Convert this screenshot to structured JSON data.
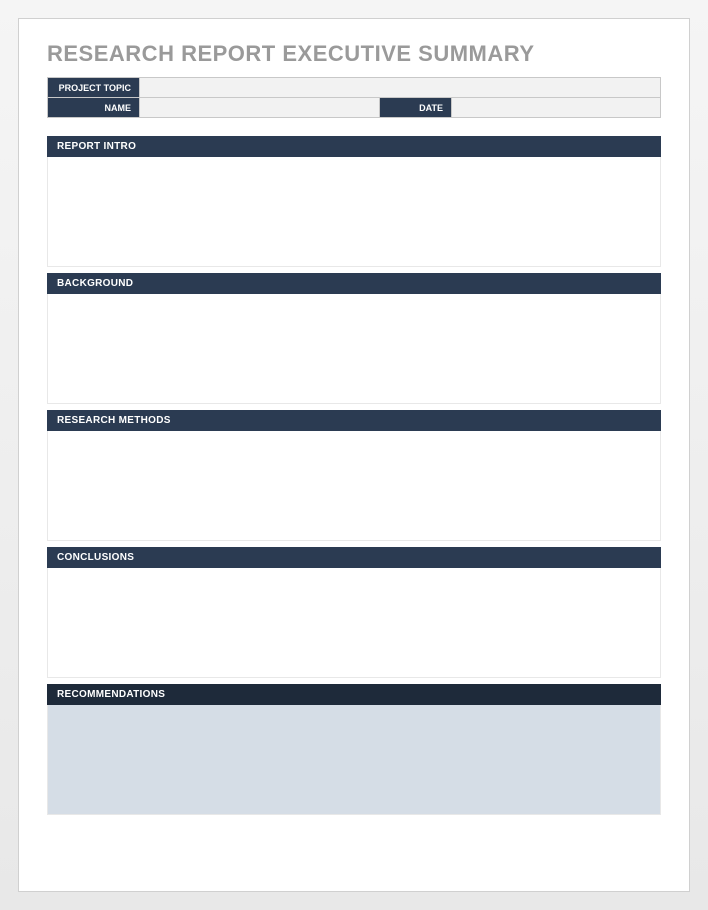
{
  "title": "RESEARCH REPORT EXECUTIVE SUMMARY",
  "meta": {
    "project_topic_label": "PROJECT TOPIC",
    "project_topic_value": "",
    "name_label": "NAME",
    "name_value": "",
    "date_label": "DATE",
    "date_value": ""
  },
  "sections": {
    "report_intro": {
      "label": "REPORT INTRO",
      "value": ""
    },
    "background": {
      "label": "BACKGROUND",
      "value": ""
    },
    "research_methods": {
      "label": "RESEARCH METHODS",
      "value": ""
    },
    "conclusions": {
      "label": "CONCLUSIONS",
      "value": ""
    },
    "recommendations": {
      "label": "RECOMMENDATIONS",
      "value": ""
    }
  }
}
